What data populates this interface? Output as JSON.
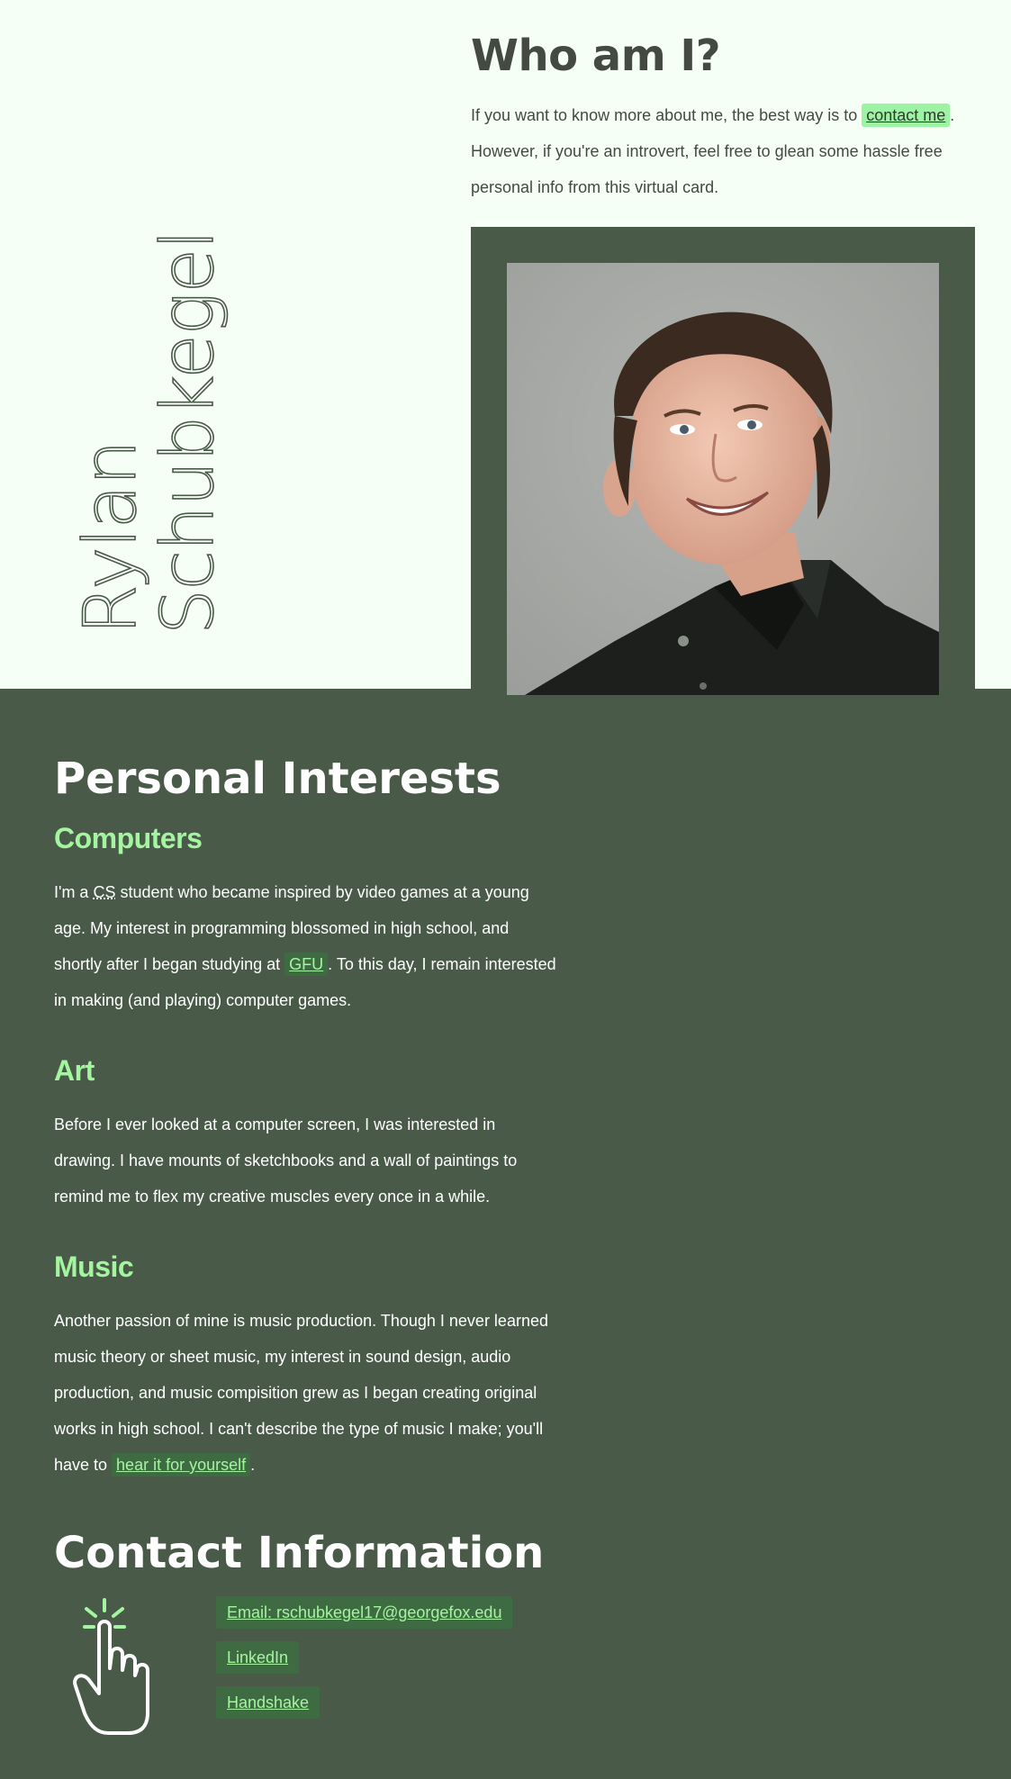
{
  "hero": {
    "name_line1": "Rylan",
    "name_line2": "Schubkegel"
  },
  "about": {
    "title": "Who am I?",
    "text_before_link": "If you want to know more about me, the best way is to ",
    "contact_link": "contact me",
    "text_after_link": ". However, if you're an introvert, feel free to glean some hassle free personal info from this virtual card."
  },
  "interests": {
    "title": "Personal Interests",
    "computers": {
      "heading": "Computers",
      "p1": "I'm a ",
      "abbr": "CS",
      "p2": " student who became inspired by video games at a young age. My interest in programming blossomed in high school, and shortly after I began studying at ",
      "link": "GFU",
      "p3": ". To this day, I remain interested in making (and playing) computer games."
    },
    "art": {
      "heading": "Art",
      "text": "Before I ever looked at a computer screen, I was interested in drawing. I have mounts of sketchbooks and a wall of paintings to remind me to flex my creative muscles every once in a while."
    },
    "music": {
      "heading": "Music",
      "p1": "Another passion of mine is music production. Though I never learned music theory or sheet music, my interest in sound design, audio production, and music compisition grew as I began creating original works in high school. I can't describe the type of music I make; you'll have to ",
      "link": "hear it for yourself",
      "p2": "."
    }
  },
  "contact": {
    "title": "Contact Information",
    "links": [
      "Email: rschubkegel17@georgefox.edu",
      "LinkedIn",
      "Handshake"
    ]
  },
  "colors": {
    "background_light": "#f5fff5",
    "background_dark": "#4a5a49",
    "accent_green": "#a4f5a0",
    "highlight": "#9df3a3"
  }
}
